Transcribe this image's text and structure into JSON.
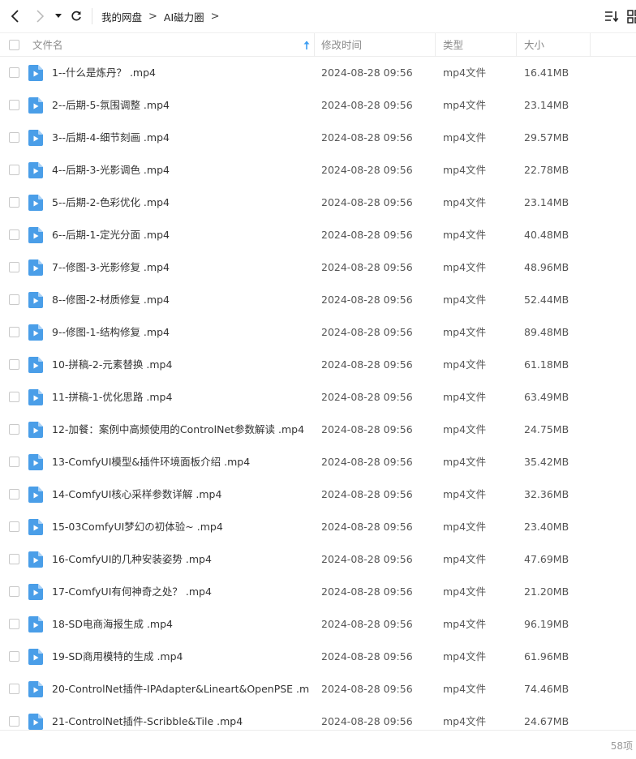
{
  "breadcrumb": [
    "我的网盘",
    "AI磁力圈"
  ],
  "header": {
    "name": "文件名",
    "modified": "修改时间",
    "type": "类型",
    "size": "大小"
  },
  "files": [
    {
      "name": "1--什么是炼丹？ .mp4",
      "modified": "2024-08-28 09:56",
      "type": "mp4文件",
      "size": "16.41MB"
    },
    {
      "name": "2--后期-5-氛围调整 .mp4",
      "modified": "2024-08-28 09:56",
      "type": "mp4文件",
      "size": "23.14MB"
    },
    {
      "name": "3--后期-4-细节刻画 .mp4",
      "modified": "2024-08-28 09:56",
      "type": "mp4文件",
      "size": "29.57MB"
    },
    {
      "name": "4--后期-3-光影调色 .mp4",
      "modified": "2024-08-28 09:56",
      "type": "mp4文件",
      "size": "22.78MB"
    },
    {
      "name": "5--后期-2-色彩优化 .mp4",
      "modified": "2024-08-28 09:56",
      "type": "mp4文件",
      "size": "23.14MB"
    },
    {
      "name": "6--后期-1-定光分面 .mp4",
      "modified": "2024-08-28 09:56",
      "type": "mp4文件",
      "size": "40.48MB"
    },
    {
      "name": "7--修图-3-光影修复 .mp4",
      "modified": "2024-08-28 09:56",
      "type": "mp4文件",
      "size": "48.96MB"
    },
    {
      "name": "8--修图-2-材质修复 .mp4",
      "modified": "2024-08-28 09:56",
      "type": "mp4文件",
      "size": "52.44MB"
    },
    {
      "name": "9--修图-1-结构修复 .mp4",
      "modified": "2024-08-28 09:56",
      "type": "mp4文件",
      "size": "89.48MB"
    },
    {
      "name": "10-拼稿-2-元素替换 .mp4",
      "modified": "2024-08-28 09:56",
      "type": "mp4文件",
      "size": "61.18MB"
    },
    {
      "name": "11-拼稿-1-优化思路 .mp4",
      "modified": "2024-08-28 09:56",
      "type": "mp4文件",
      "size": "63.49MB"
    },
    {
      "name": "12-加餐：案例中高频使用的ControlNet参数解读 .mp4",
      "modified": "2024-08-28 09:56",
      "type": "mp4文件",
      "size": "24.75MB"
    },
    {
      "name": "13-ComfyUI模型&插件环境面板介绍 .mp4",
      "modified": "2024-08-28 09:56",
      "type": "mp4文件",
      "size": "35.42MB"
    },
    {
      "name": "14-ComfyUI核心采样参数详解 .mp4",
      "modified": "2024-08-28 09:56",
      "type": "mp4文件",
      "size": "32.36MB"
    },
    {
      "name": "15-03ComfyUI梦幻の初体验~ .mp4",
      "modified": "2024-08-28 09:56",
      "type": "mp4文件",
      "size": "23.40MB"
    },
    {
      "name": "16-ComfyUI的几种安装姿势 .mp4",
      "modified": "2024-08-28 09:56",
      "type": "mp4文件",
      "size": "47.69MB"
    },
    {
      "name": "17-ComfyUI有何神奇之处？ .mp4",
      "modified": "2024-08-28 09:56",
      "type": "mp4文件",
      "size": "21.20MB"
    },
    {
      "name": "18-SD电商海报生成 .mp4",
      "modified": "2024-08-28 09:56",
      "type": "mp4文件",
      "size": "96.19MB"
    },
    {
      "name": "19-SD商用模特的生成 .mp4",
      "modified": "2024-08-28 09:56",
      "type": "mp4文件",
      "size": "61.96MB"
    },
    {
      "name": "20-ControlNet插件-IPAdapter&Lineart&OpenPSE .m...",
      "modified": "2024-08-28 09:56",
      "type": "mp4文件",
      "size": "74.46MB"
    },
    {
      "name": "21-ControlNet插件-Scribble&Tile .mp4",
      "modified": "2024-08-28 09:56",
      "type": "mp4文件",
      "size": "24.67MB"
    }
  ],
  "footer": {
    "count": "58项"
  },
  "colors": {
    "accent": "#3d9df2",
    "icon_blue": "#4a9ee8"
  }
}
